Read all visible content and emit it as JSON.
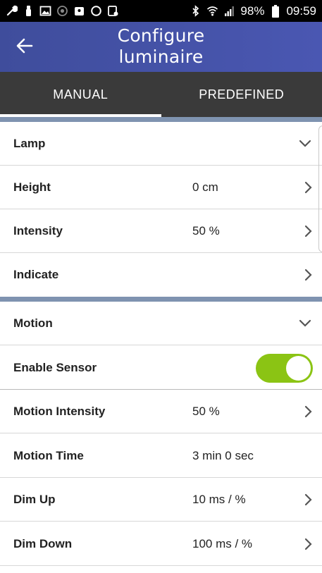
{
  "status_bar": {
    "battery_percent": "98%",
    "time": "09:59",
    "left_icons": [
      "wrench-icon",
      "stick-icon",
      "image-icon",
      "target-icon",
      "bag-icon",
      "circle-icon",
      "notification-icon"
    ],
    "right_icons": [
      "bluetooth-icon",
      "wifi-icon",
      "signal-icon",
      "battery-icon"
    ]
  },
  "app_bar": {
    "title_line1": "Configure",
    "title_line2": "luminaire",
    "back_icon": "arrow-left-icon"
  },
  "tabs": [
    {
      "label": "MANUAL",
      "active": true
    },
    {
      "label": "PREDEFINED",
      "active": false
    }
  ],
  "sections": {
    "lamp": {
      "title": "Lamp",
      "rows": [
        {
          "label": "Height",
          "value": "0 cm"
        },
        {
          "label": "Intensity",
          "value": "50 %"
        },
        {
          "label": "Indicate",
          "value": ""
        }
      ]
    },
    "motion": {
      "title": "Motion",
      "enable_sensor": {
        "label": "Enable Sensor",
        "on": true
      },
      "rows": [
        {
          "label": "Motion Intensity",
          "value": "50 %"
        },
        {
          "label": "Motion Time",
          "value": "3 min 0 sec"
        },
        {
          "label": "Dim Up",
          "value": "10 ms / %"
        },
        {
          "label": "Dim Down",
          "value": "100 ms / %"
        }
      ]
    }
  },
  "colors": {
    "app_bar_start": "#3f4d9c",
    "app_bar_end": "#4a57b2",
    "tab_bar": "#3a3a3a",
    "section_band": "#7f93b0",
    "toggle_on": "#8bc414"
  }
}
